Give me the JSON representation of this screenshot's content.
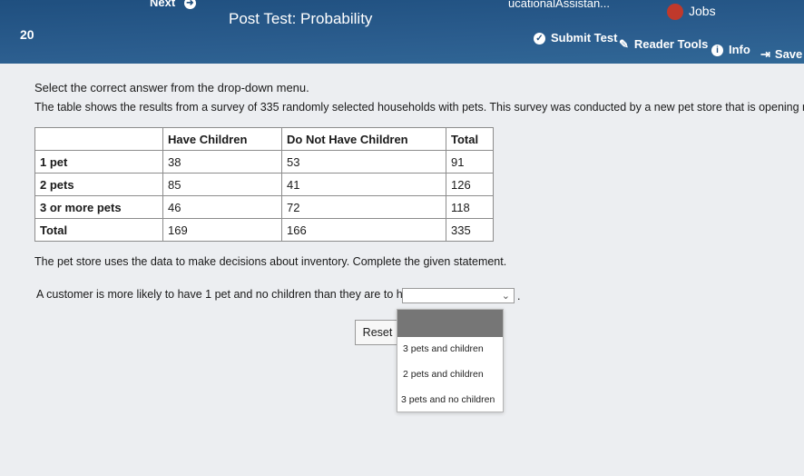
{
  "header": {
    "next_label": "Next",
    "question_number": "20",
    "title": "Post Test: Probability",
    "assistant_label": "ucationalAssistan...",
    "jobs_label": "Jobs",
    "submit_label": "Submit Test",
    "reader_tools_label": "Reader Tools",
    "info_label": "Info",
    "save_label": "Save &"
  },
  "question": {
    "instruction": "Select the correct answer from the drop-down menu.",
    "description": "The table shows the results from a survey of 335 randomly selected households with pets. This survey was conducted by a new pet store that is opening nearby.",
    "after_table": "The pet store uses the data to make decisions about inventory. Complete the given statement.",
    "statement": "A customer is more likely to have 1 pet and no children than they are to have",
    "statement_end": "."
  },
  "table": {
    "columns": [
      "",
      "Have Children",
      "Do Not Have Children",
      "Total"
    ],
    "rows": [
      {
        "label": "1 pet",
        "have": "38",
        "not": "53",
        "total": "91"
      },
      {
        "label": "2 pets",
        "have": "85",
        "not": "41",
        "total": "126"
      },
      {
        "label": "3 or more pets",
        "have": "46",
        "not": "72",
        "total": "118"
      },
      {
        "label": "Total",
        "have": "169",
        "not": "166",
        "total": "335"
      }
    ]
  },
  "dropdown": {
    "options": [
      "3 pets and children",
      "2 pets and children",
      "3 pets and no children"
    ]
  },
  "reset_label": "Reset"
}
